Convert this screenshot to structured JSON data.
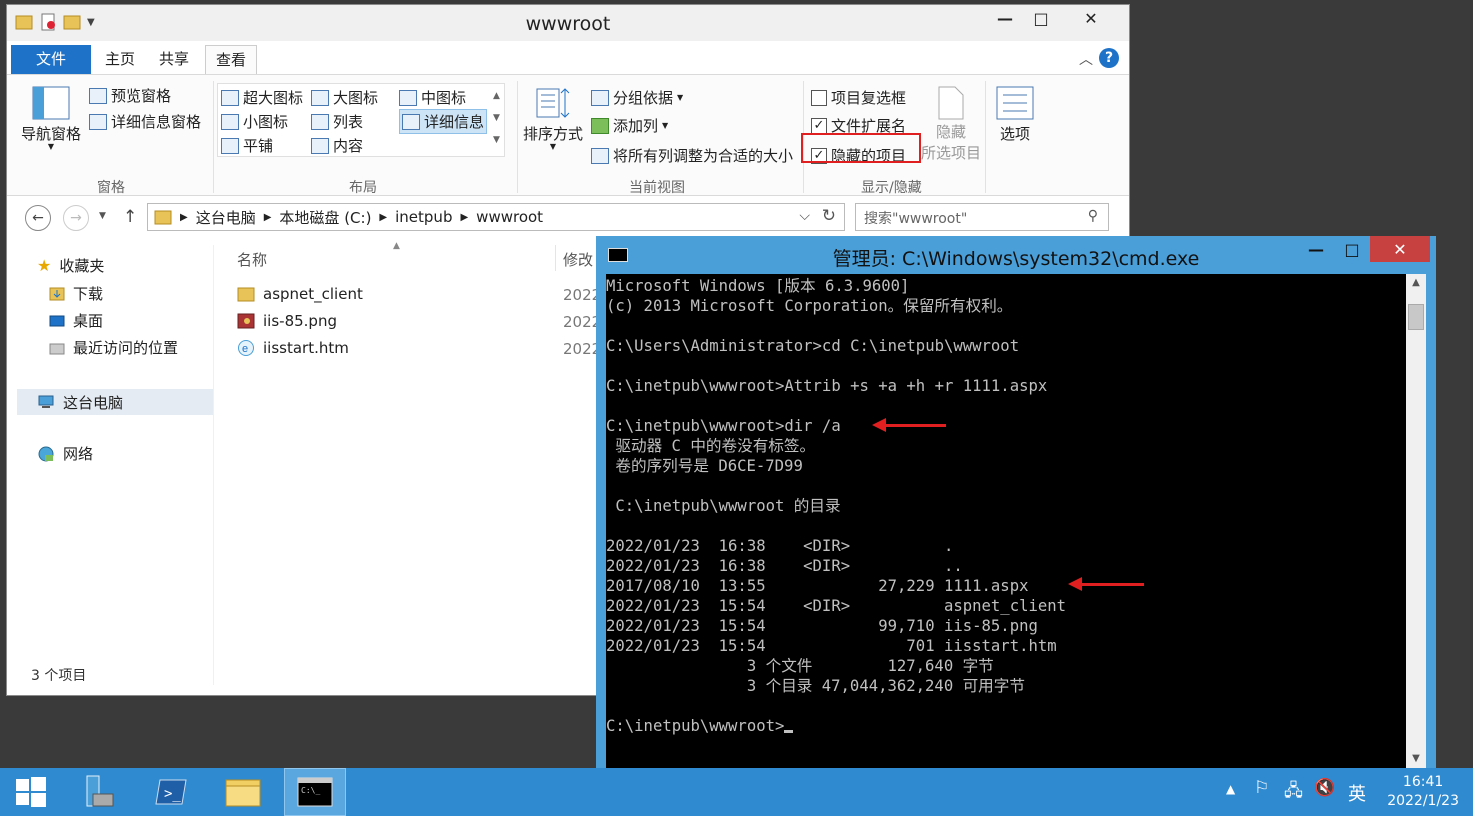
{
  "explorer": {
    "title": "wwwroot",
    "tabs": {
      "file": "文件",
      "home": "主页",
      "share": "共享",
      "view": "查看"
    },
    "panes": {
      "nav_pane": "导航窗格",
      "preview_pane": "预览窗格",
      "details_pane": "详细信息窗格",
      "group_label": "窗格"
    },
    "layout": {
      "extra_large": "超大图标",
      "large": "大图标",
      "medium": "中图标",
      "small": "小图标",
      "list": "列表",
      "details": "详细信息",
      "tiles": "平铺",
      "content": "内容",
      "group_label": "布局"
    },
    "current_view": {
      "sort_by": "排序方式",
      "group_by": "分组依据",
      "add_columns": "添加列",
      "size_all_columns": "将所有列调整为合适的大小",
      "group_label": "当前视图"
    },
    "show_hide": {
      "item_checkboxes": "项目复选框",
      "item_checkboxes_checked": false,
      "file_extensions": "文件扩展名",
      "file_extensions_checked": true,
      "hidden_items": "隐藏的项目",
      "hidden_items_checked": true,
      "hide_selected_line1": "隐藏",
      "hide_selected_line2": "所选项目",
      "group_label": "显示/隐藏"
    },
    "options": "选项",
    "address": {
      "crumbs": [
        "这台电脑",
        "本地磁盘 (C:)",
        "inetpub",
        "wwwroot"
      ],
      "search_placeholder": "搜索\"wwwroot\""
    },
    "nav": {
      "favorites": "收藏夹",
      "downloads": "下载",
      "desktop": "桌面",
      "recent": "最近访问的位置",
      "this_pc": "这台电脑",
      "network": "网络"
    },
    "columns": {
      "name": "名称",
      "modified": "修改"
    },
    "files": [
      {
        "name": "aspnet_client",
        "date": "2022",
        "icon": "folder-icon"
      },
      {
        "name": "iis-85.png",
        "date": "2022",
        "icon": "image-file-icon"
      },
      {
        "name": "iisstart.htm",
        "date": "2022",
        "icon": "html-file-icon"
      }
    ],
    "status": "3 个项目"
  },
  "cmd": {
    "title": "管理员: C:\\Windows\\system32\\cmd.exe",
    "lines": [
      "Microsoft Windows [版本 6.3.9600]",
      "(c) 2013 Microsoft Corporation。保留所有权利。",
      "",
      "C:\\Users\\Administrator>cd C:\\inetpub\\wwwroot",
      "",
      "C:\\inetpub\\wwwroot>Attrib +s +a +h +r 1111.aspx",
      "",
      "C:\\inetpub\\wwwroot>dir /a",
      " 驱动器 C 中的卷没有标签。",
      " 卷的序列号是 D6CE-7D99",
      "",
      " C:\\inetpub\\wwwroot 的目录",
      "",
      "2022/01/23  16:38    <DIR>          .",
      "2022/01/23  16:38    <DIR>          ..",
      "2017/08/10  13:55            27,229 1111.aspx",
      "2022/01/23  15:54    <DIR>          aspnet_client",
      "2022/01/23  15:54            99,710 iis-85.png",
      "2022/01/23  15:54               701 iisstart.htm",
      "               3 个文件        127,640 字节",
      "               3 个目录 47,044,362,240 可用字节",
      ""
    ],
    "prompt": "C:\\inetpub\\wwwroot>"
  },
  "taskbar": {
    "ime": "英",
    "time": "16:41",
    "date": "2022/1/23"
  },
  "colors": {
    "taskbar": "#2f8ad0",
    "cmd_frame": "#4a9fd8",
    "annotation_red": "#e02020",
    "ribbon_file_tab": "#1e73c8"
  }
}
